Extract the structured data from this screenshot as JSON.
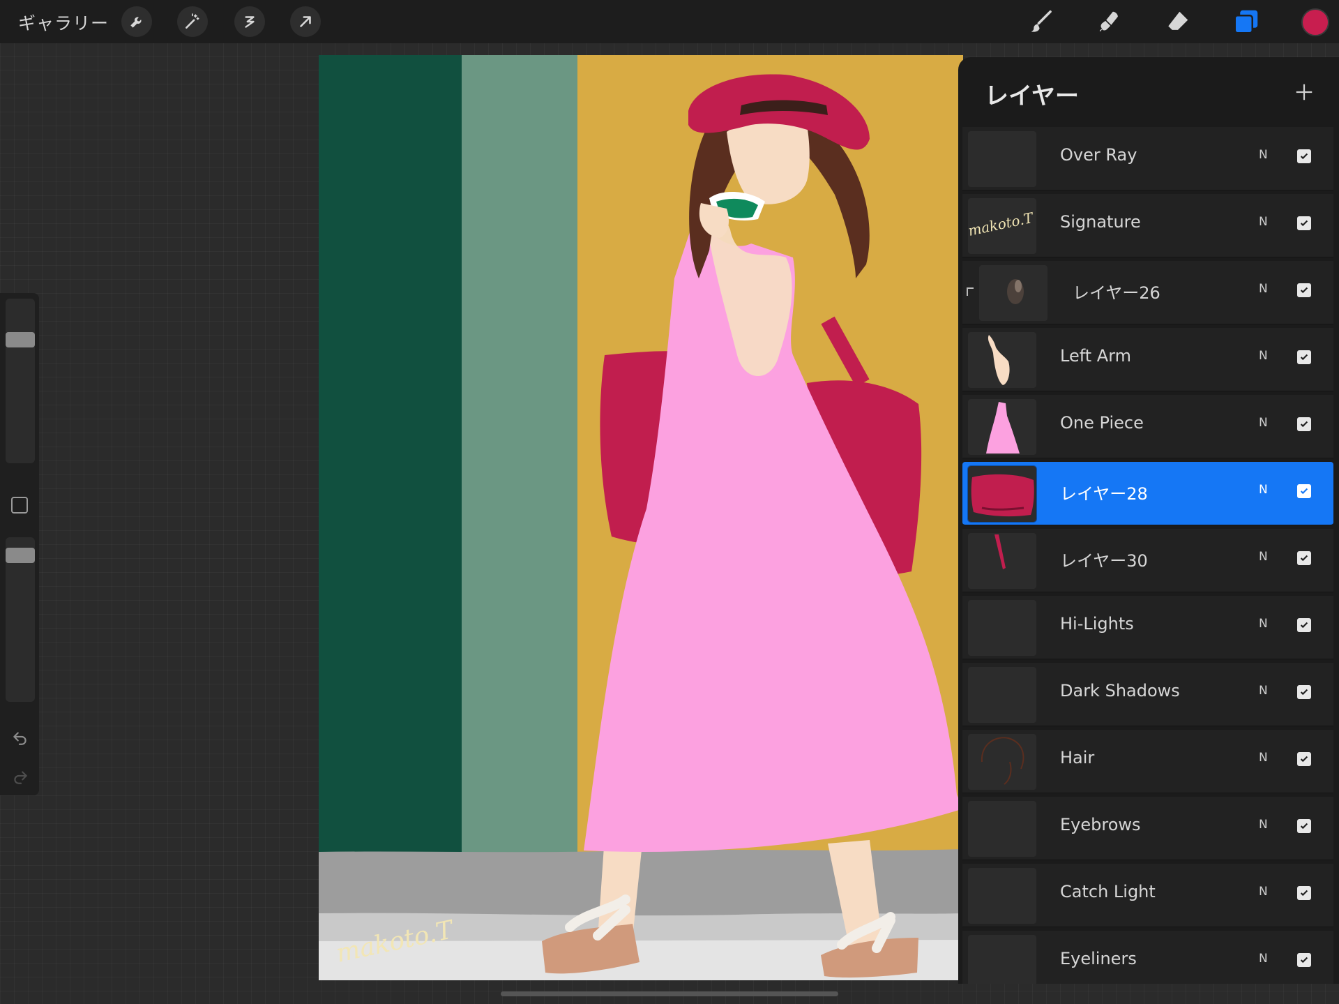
{
  "topbar": {
    "gallery_label": "ギャラリー",
    "tools_left": [
      "wrench-icon",
      "magic-wand-icon",
      "selection-icon",
      "transform-arrow-icon"
    ],
    "tools_right": [
      "brush-icon",
      "smudge-icon",
      "eraser-icon",
      "layers-icon"
    ],
    "active_color": "#c81e4f",
    "accent_color": "#1577f5"
  },
  "panel": {
    "title": "レイヤー",
    "add_icon": "plus-icon",
    "layers": [
      {
        "name": "Over Ray",
        "blend": "N",
        "visible": true
      },
      {
        "name": "Signature",
        "blend": "N",
        "visible": true
      },
      {
        "name": "レイヤー26",
        "blend": "N",
        "visible": true,
        "clipped": true
      },
      {
        "name": "Left Arm",
        "blend": "N",
        "visible": true
      },
      {
        "name": "One Piece",
        "blend": "N",
        "visible": true
      },
      {
        "name": "レイヤー28",
        "blend": "N",
        "visible": true,
        "selected": true
      },
      {
        "name": "レイヤー30",
        "blend": "N",
        "visible": true
      },
      {
        "name": "Hi-Lights",
        "blend": "N",
        "visible": true
      },
      {
        "name": "Dark Shadows",
        "blend": "N",
        "visible": true
      },
      {
        "name": "Hair",
        "blend": "N",
        "visible": true
      },
      {
        "name": "Eyebrows",
        "blend": "N",
        "visible": true
      },
      {
        "name": "Catch Light",
        "blend": "N",
        "visible": true
      },
      {
        "name": "Eyeliners",
        "blend": "N",
        "visible": true
      }
    ]
  },
  "canvas": {
    "signature_text": "makoto.T",
    "colors": {
      "dark_green": "#11503f",
      "sage": "#6b9783",
      "mustard": "#d8ab44",
      "dress_pink": "#fca1e0",
      "bag_red": "#c11e4e",
      "skin": "#f7dcc4",
      "hair": "#5a2e1f",
      "pavement": "#9d9d9d"
    }
  }
}
